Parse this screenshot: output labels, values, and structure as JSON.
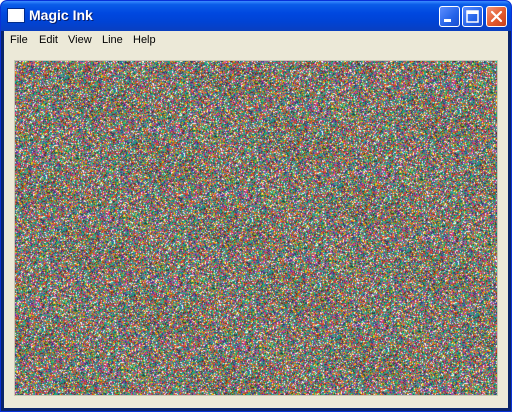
{
  "window": {
    "title": "Magic Ink"
  },
  "titlebar_buttons": {
    "minimize": "minimize",
    "maximize": "maximize",
    "close": "close"
  },
  "menu": {
    "items": [
      "File",
      "Edit",
      "View",
      "Line",
      "Help"
    ]
  },
  "canvas": {
    "palette": [
      "#c0392b",
      "#27ae60",
      "#2c3e8f",
      "#8e44ad",
      "#f1c40f",
      "#16a085",
      "#d35400",
      "#7f8c8d",
      "#ffffff",
      "#1abc9c",
      "#e84393",
      "#2d3436"
    ]
  }
}
